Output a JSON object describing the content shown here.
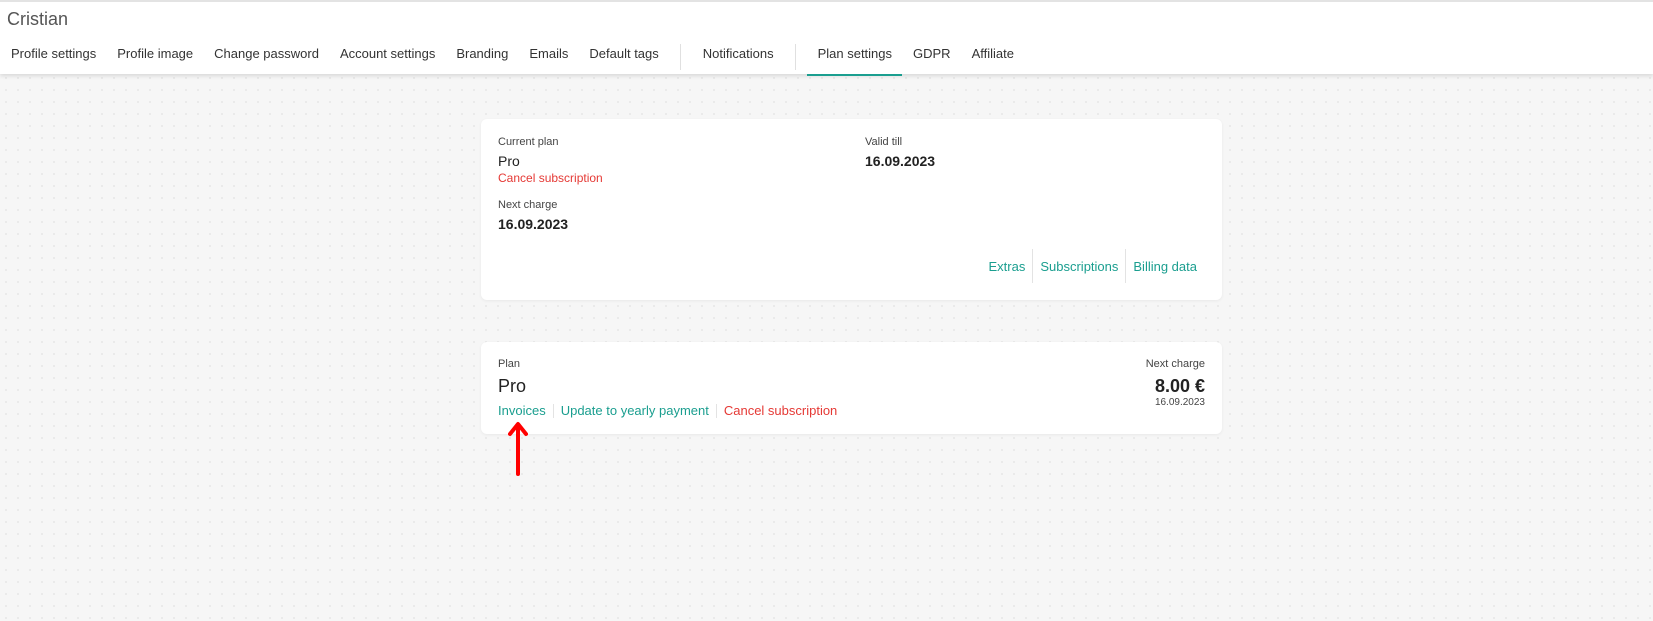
{
  "header": {
    "user_name": "Cristian",
    "tabs": [
      {
        "label": "Profile settings"
      },
      {
        "label": "Profile image"
      },
      {
        "label": "Change password"
      },
      {
        "label": "Account settings"
      },
      {
        "label": "Branding"
      },
      {
        "label": "Emails"
      },
      {
        "label": "Default tags"
      },
      {
        "label": "Notifications"
      },
      {
        "label": "Plan settings",
        "active": true
      },
      {
        "label": "GDPR"
      },
      {
        "label": "Affiliate"
      }
    ]
  },
  "summary_card": {
    "current_plan_label": "Current plan",
    "current_plan_value": "Pro",
    "cancel_label": "Cancel subscription",
    "valid_till_label": "Valid till",
    "valid_till_value": "16.09.2023",
    "next_charge_label": "Next charge",
    "next_charge_value": "16.09.2023",
    "links": {
      "extras": "Extras",
      "subscriptions": "Subscriptions",
      "billing_data": "Billing data"
    }
  },
  "plan_card": {
    "plan_label": "Plan",
    "plan_value": "Pro",
    "invoices": "Invoices",
    "update_yearly": "Update to yearly payment",
    "cancel": "Cancel subscription",
    "next_charge_label": "Next charge",
    "price": "8.00 €",
    "date": "16.09.2023"
  },
  "colors": {
    "accent": "#1a9e8f",
    "danger": "#e53935",
    "annotation_arrow": "#ff0000"
  },
  "icons": {
    "annotation": "arrow-up-icon"
  }
}
